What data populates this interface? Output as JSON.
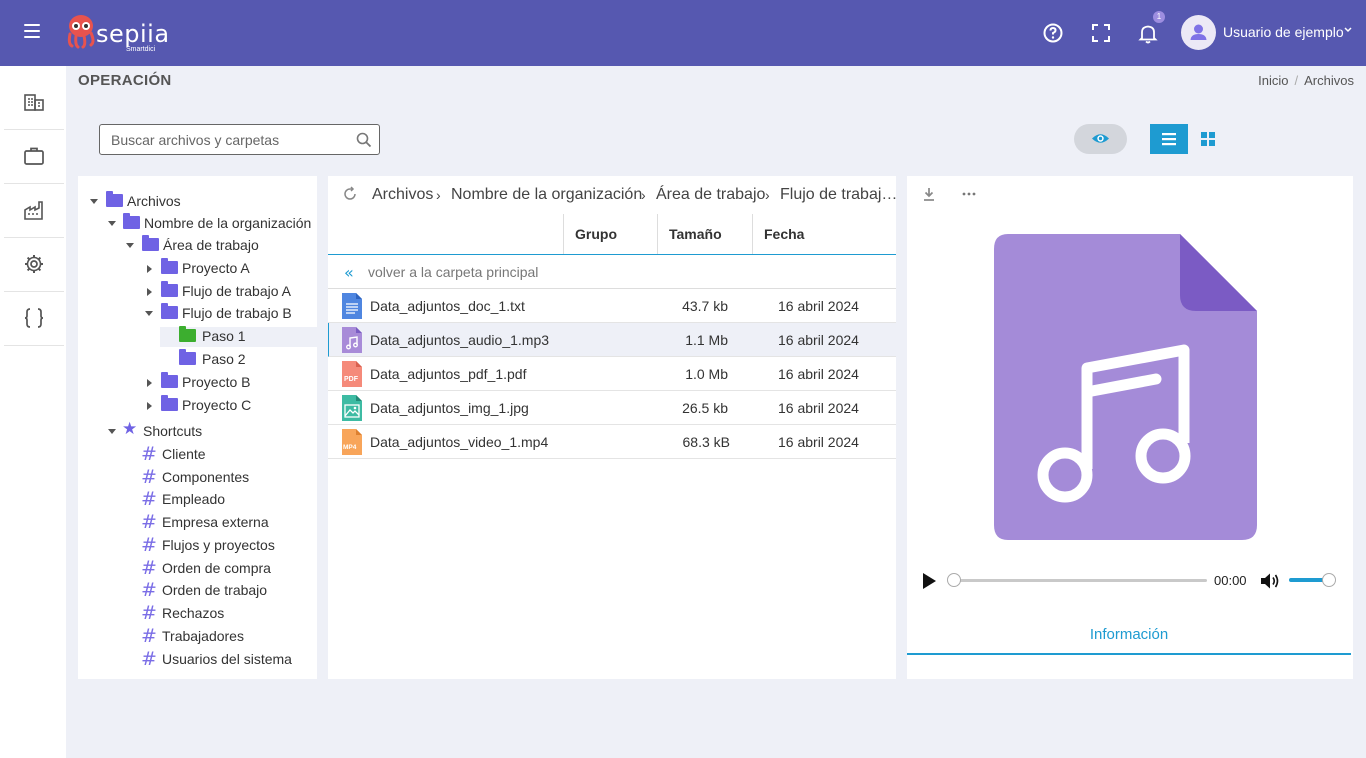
{
  "header": {
    "logo_text": "sepiia",
    "logo_sub": "Smartdici",
    "notifications_count": "1",
    "user_name": "Usuario de ejemplo",
    "colors": {
      "bar": "#5658b0",
      "accent": "#1e9bd1",
      "folder": "#6f62e4"
    }
  },
  "page": {
    "title": "OPERACIÓN",
    "breadcrumb": [
      "Inicio",
      "Archivos"
    ]
  },
  "search": {
    "placeholder": "Buscar archivos y carpetas",
    "value": ""
  },
  "tree": {
    "root": "Archivos",
    "org": "Nombre de la organización",
    "area": "Área de trabajo",
    "proyecto_a": "Proyecto A",
    "flujo_a": "Flujo de trabajo A",
    "flujo_b": "Flujo de trabajo B",
    "paso1": "Paso 1",
    "paso2": "Paso 2",
    "proyecto_b": "Proyecto B",
    "proyecto_c": "Proyecto C",
    "shortcuts_label": "Shortcuts",
    "shortcuts": [
      "Cliente",
      "Componentes",
      "Empleado",
      "Empresa externa",
      "Flujos y proyectos",
      "Orden de compra",
      "Orden de trabajo",
      "Rechazos",
      "Trabajadores",
      "Usuarios del sistema"
    ]
  },
  "files": {
    "path": [
      "Archivos",
      "Nombre de la organización",
      "Área de trabajo",
      "Flujo de trabaj…"
    ],
    "columns": {
      "group": "Grupo",
      "size": "Tamaño",
      "date": "Fecha"
    },
    "back_label": "volver a la carpeta principal",
    "rows": [
      {
        "name": "Data_adjuntos_doc_1.txt",
        "size": "43.7 kb",
        "date": "16 abril 2024",
        "icon": "doc-file-icon"
      },
      {
        "name": "Data_adjuntos_audio_1.mp3",
        "size": "1.1 Mb",
        "date": "16 abril 2024",
        "icon": "audio-file-icon"
      },
      {
        "name": "Data_adjuntos_pdf_1.pdf",
        "size": "1.0 Mb",
        "date": "16 abril 2024",
        "icon": "pdf-file-icon"
      },
      {
        "name": "Data_adjuntos_img_1.jpg",
        "size": "26.5 kb",
        "date": "16 abril 2024",
        "icon": "image-file-icon"
      },
      {
        "name": "Data_adjuntos_video_1.mp4",
        "size": "68.3 kB",
        "date": "16 abril 2024",
        "icon": "video-file-icon"
      }
    ]
  },
  "preview": {
    "time": "00:00",
    "volume_level": 0.85,
    "progress": 0,
    "info_tab": "Información",
    "pdf_tag": "PDF",
    "mp4_tag": "MP4"
  }
}
